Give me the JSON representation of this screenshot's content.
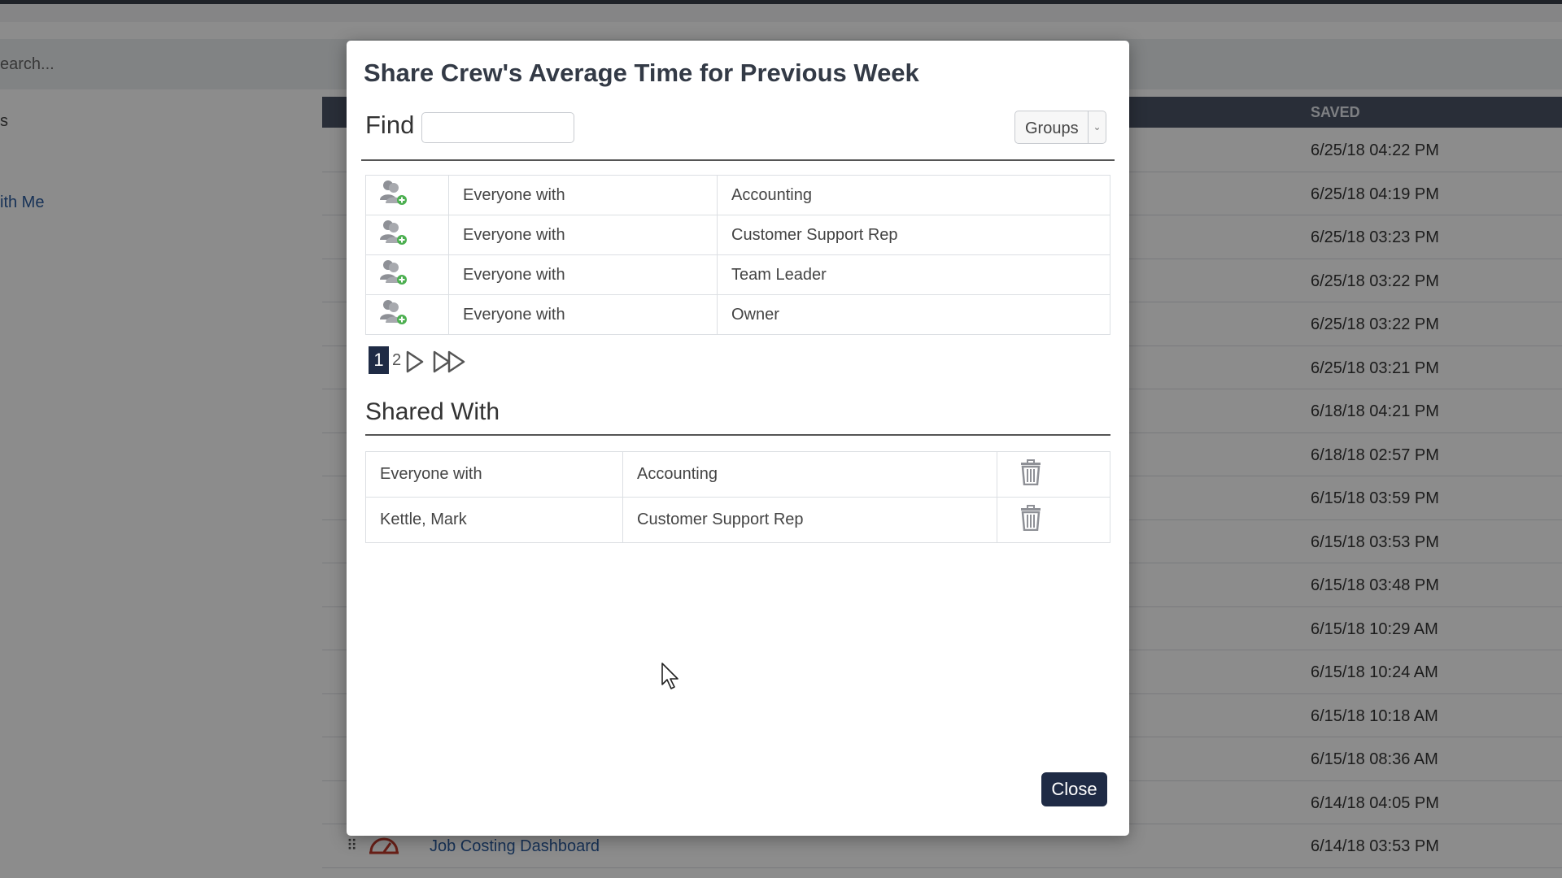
{
  "background": {
    "search_placeholder": "earch...",
    "sidebar_item_a": "s",
    "sidebar_item_b": "ith Me",
    "saved_header": "SAVED",
    "saved_dates": [
      "6/25/18 04:22 PM",
      "6/25/18 04:19 PM",
      "6/25/18 03:23 PM",
      "6/25/18 03:22 PM",
      "6/25/18 03:22 PM",
      "6/25/18 03:21 PM",
      "6/18/18 04:21 PM",
      "6/18/18 02:57 PM",
      "6/15/18 03:59 PM",
      "6/15/18 03:53 PM",
      "6/15/18 03:48 PM",
      "6/15/18 10:29 AM",
      "6/15/18 10:24 AM",
      "6/15/18 10:18 AM",
      "6/15/18 08:36 AM",
      "6/14/18 04:05 PM",
      "6/14/18 03:53 PM"
    ],
    "last_row_link": "Job Costing Dashboard",
    "link_color": "#2a5b9e",
    "header_color": "#4b5567"
  },
  "modal": {
    "title": "Share Crew's Average Time for Previous Week",
    "find_label": "Find",
    "find_value": "",
    "groups_select": "Groups",
    "find_results": [
      {
        "icon": "add-user-icon",
        "who": "Everyone with",
        "role": "Accounting"
      },
      {
        "icon": "add-user-icon",
        "who": "Everyone with",
        "role": "Customer Support Rep"
      },
      {
        "icon": "add-user-icon",
        "who": "Everyone with",
        "role": "Team Leader"
      },
      {
        "icon": "add-user-icon",
        "who": "Everyone with",
        "role": "Owner"
      }
    ],
    "pager": {
      "current": "1",
      "next_page": "2"
    },
    "shared_title": "Shared With",
    "shared_rows": [
      {
        "who": "Everyone with",
        "role": "Accounting",
        "icon": "trash-icon"
      },
      {
        "who": "Kettle, Mark",
        "role": "Customer Support Rep",
        "icon": "trash-icon"
      }
    ],
    "close_label": "Close",
    "accent_color": "#1f2b45"
  }
}
